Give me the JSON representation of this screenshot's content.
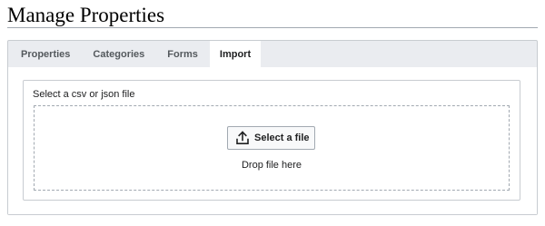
{
  "page": {
    "title": "Manage Properties"
  },
  "tabs": [
    {
      "label": "Properties",
      "selected": false
    },
    {
      "label": "Categories",
      "selected": false
    },
    {
      "label": "Forms",
      "selected": false
    },
    {
      "label": "Import",
      "selected": true
    }
  ],
  "import": {
    "field_label": "Select a csv or json file",
    "select_button": {
      "label": "Select a file",
      "icon": "upload-icon"
    },
    "drop_text": "Drop file here"
  },
  "colors": {
    "panel_background": "#eaecf0",
    "border": "#c8ccd1",
    "dropzone_border": "#a2a9b1",
    "button_background": "#f8f9fa",
    "text": "#202122",
    "inactive_tab_text": "#54595d"
  }
}
